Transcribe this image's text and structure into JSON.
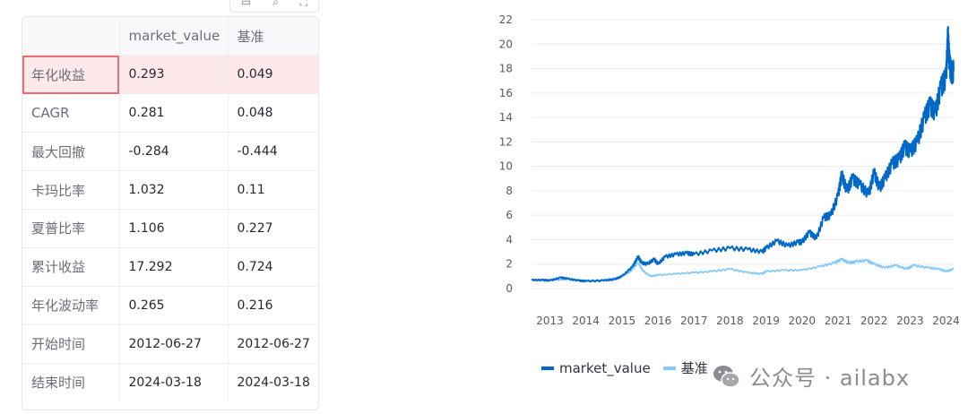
{
  "toolbar": {
    "icons": [
      "download-icon",
      "search-icon",
      "fullscreen-icon"
    ]
  },
  "table": {
    "columns": [
      "",
      "market_value",
      "基准"
    ],
    "rows": [
      {
        "label": "年化收益",
        "mv": "0.293",
        "bm": "0.049",
        "highlighted": true
      },
      {
        "label": "CAGR",
        "mv": "0.281",
        "bm": "0.048"
      },
      {
        "label": "最大回撤",
        "mv": "-0.284",
        "bm": "-0.444"
      },
      {
        "label": "卡玛比率",
        "mv": "1.032",
        "bm": "0.11"
      },
      {
        "label": "夏普比率",
        "mv": "1.106",
        "bm": "0.227"
      },
      {
        "label": "累计收益",
        "mv": "17.292",
        "bm": "0.724"
      },
      {
        "label": "年化波动率",
        "mv": "0.265",
        "bm": "0.216"
      },
      {
        "label": "开始时间",
        "mv": "2012-06-27",
        "bm": "2012-06-27"
      },
      {
        "label": "结束时间",
        "mv": "2024-03-18",
        "bm": "2024-03-18"
      }
    ]
  },
  "chart_data": {
    "type": "line",
    "x_ticks": [
      "2013",
      "2014",
      "2015",
      "2016",
      "2017",
      "2018",
      "2019",
      "2020",
      "2021",
      "2022",
      "2023",
      "2024"
    ],
    "y_ticks": [
      0,
      2,
      4,
      6,
      8,
      10,
      12,
      14,
      16,
      18,
      20,
      22
    ],
    "ylim": [
      0,
      22
    ],
    "xlim": [
      2012.49,
      2024.21
    ],
    "legend_position": "bottom",
    "series": [
      {
        "name": "market_value",
        "color": "#0068c9",
        "points": [
          [
            2012.49,
            0.7
          ],
          [
            2012.8,
            0.7
          ],
          [
            2013.0,
            0.65
          ],
          [
            2013.3,
            0.9
          ],
          [
            2013.5,
            0.8
          ],
          [
            2013.8,
            0.65
          ],
          [
            2014.0,
            0.6
          ],
          [
            2014.5,
            0.65
          ],
          [
            2014.8,
            0.75
          ],
          [
            2015.0,
            1.0
          ],
          [
            2015.3,
            1.8
          ],
          [
            2015.45,
            2.6
          ],
          [
            2015.55,
            2.1
          ],
          [
            2015.7,
            2.0
          ],
          [
            2015.9,
            2.4
          ],
          [
            2016.0,
            2.0
          ],
          [
            2016.2,
            2.6
          ],
          [
            2016.5,
            2.8
          ],
          [
            2016.8,
            2.9
          ],
          [
            2017.0,
            2.8
          ],
          [
            2017.5,
            3.1
          ],
          [
            2018.0,
            3.3
          ],
          [
            2018.5,
            3.2
          ],
          [
            2018.9,
            3.0
          ],
          [
            2019.0,
            3.3
          ],
          [
            2019.3,
            3.9
          ],
          [
            2019.6,
            3.5
          ],
          [
            2019.9,
            3.8
          ],
          [
            2020.0,
            3.8
          ],
          [
            2020.2,
            4.6
          ],
          [
            2020.4,
            4.1
          ],
          [
            2020.6,
            5.8
          ],
          [
            2020.8,
            6.0
          ],
          [
            2021.0,
            7.6
          ],
          [
            2021.1,
            9.3
          ],
          [
            2021.25,
            8.0
          ],
          [
            2021.4,
            9.0
          ],
          [
            2021.6,
            8.5
          ],
          [
            2021.85,
            7.7
          ],
          [
            2022.0,
            9.5
          ],
          [
            2022.15,
            8.2
          ],
          [
            2022.3,
            9.0
          ],
          [
            2022.5,
            10.2
          ],
          [
            2022.7,
            10.6
          ],
          [
            2022.85,
            11.6
          ],
          [
            2023.0,
            11.2
          ],
          [
            2023.2,
            12.0
          ],
          [
            2023.4,
            14.0
          ],
          [
            2023.55,
            15.0
          ],
          [
            2023.7,
            14.4
          ],
          [
            2023.85,
            16.4
          ],
          [
            2024.0,
            17.3
          ],
          [
            2024.05,
            20.7
          ],
          [
            2024.1,
            18.3
          ],
          [
            2024.15,
            17.6
          ],
          [
            2024.21,
            17.8
          ]
        ]
      },
      {
        "name": "基准",
        "color": "#83c9ff",
        "points": [
          [
            2012.49,
            0.7
          ],
          [
            2012.8,
            0.65
          ],
          [
            2013.0,
            0.7
          ],
          [
            2013.5,
            0.75
          ],
          [
            2014.0,
            0.65
          ],
          [
            2014.5,
            0.7
          ],
          [
            2014.9,
            0.9
          ],
          [
            2015.2,
            1.3
          ],
          [
            2015.45,
            2.1
          ],
          [
            2015.6,
            1.4
          ],
          [
            2015.8,
            1.0
          ],
          [
            2016.0,
            1.1
          ],
          [
            2016.5,
            1.2
          ],
          [
            2017.0,
            1.3
          ],
          [
            2017.5,
            1.4
          ],
          [
            2018.0,
            1.6
          ],
          [
            2018.5,
            1.3
          ],
          [
            2018.9,
            1.2
          ],
          [
            2019.0,
            1.4
          ],
          [
            2019.5,
            1.5
          ],
          [
            2020.0,
            1.5
          ],
          [
            2020.5,
            1.8
          ],
          [
            2020.9,
            2.1
          ],
          [
            2021.1,
            2.4
          ],
          [
            2021.3,
            2.1
          ],
          [
            2021.5,
            2.2
          ],
          [
            2021.8,
            2.3
          ],
          [
            2022.0,
            2.0
          ],
          [
            2022.3,
            1.7
          ],
          [
            2022.6,
            1.9
          ],
          [
            2022.9,
            1.6
          ],
          [
            2023.1,
            1.9
          ],
          [
            2023.5,
            1.7
          ],
          [
            2023.8,
            1.6
          ],
          [
            2024.0,
            1.4
          ],
          [
            2024.21,
            1.6
          ]
        ]
      }
    ]
  },
  "legend": {
    "items": [
      "market_value",
      "基准"
    ]
  },
  "watermark": {
    "text": "公众号 · ailabx"
  }
}
